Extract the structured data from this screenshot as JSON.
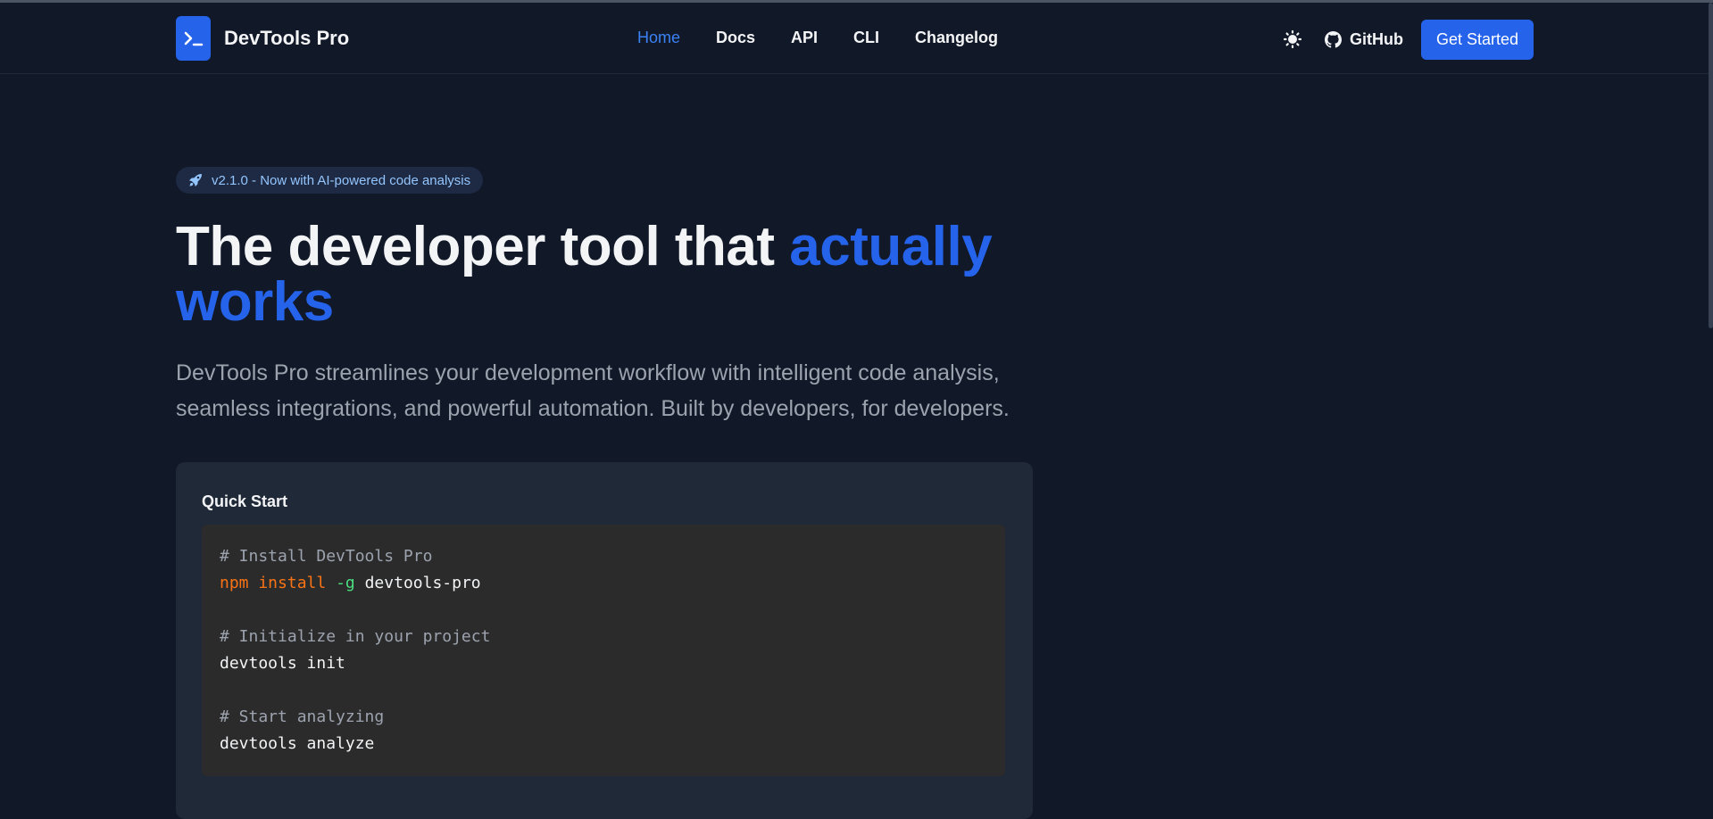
{
  "header": {
    "brand_name": "DevTools Pro",
    "nav": [
      {
        "label": "Home",
        "active": true
      },
      {
        "label": "Docs",
        "active": false
      },
      {
        "label": "API",
        "active": false
      },
      {
        "label": "CLI",
        "active": false
      },
      {
        "label": "Changelog",
        "active": false
      }
    ],
    "github_label": "GitHub",
    "cta_label": "Get Started"
  },
  "hero": {
    "badge": "v2.1.0 - Now with AI-powered code analysis",
    "title_main": "The developer tool that ",
    "title_accent": "actually works",
    "subtitle": "DevTools Pro streamlines your development workflow with intelligent code analysis, seamless integrations, and powerful automation. Built by developers, for developers."
  },
  "quick_start": {
    "title": "Quick Start",
    "code": [
      {
        "type": "comment",
        "text": "# Install DevTools Pro"
      },
      {
        "type": "npm",
        "cmd": "npm install",
        "flag": "-g",
        "arg": "devtools-pro"
      },
      {
        "type": "blank",
        "text": ""
      },
      {
        "type": "comment",
        "text": "# Initialize in your project"
      },
      {
        "type": "plain",
        "text": "devtools init"
      },
      {
        "type": "blank",
        "text": ""
      },
      {
        "type": "comment",
        "text": "# Start analyzing"
      },
      {
        "type": "plain",
        "text": "devtools analyze"
      }
    ]
  },
  "colors": {
    "background": "#111827",
    "accent": "#2563eb",
    "card": "#1f2937",
    "code_bg": "#2b2b2b"
  }
}
